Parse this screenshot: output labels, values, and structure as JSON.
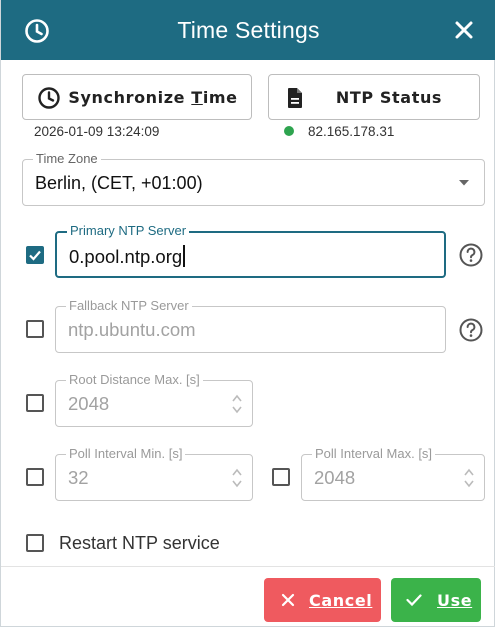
{
  "dialog": {
    "title": "Time Settings",
    "title_icon": "clock-icon",
    "close_icon": "close-icon"
  },
  "actions": {
    "sync_prefix": "Synchronize ",
    "sync_underline": "T",
    "sync_suffix": "ime",
    "sync_icon": "clock-icon",
    "sync_time": "2026-01-09 13:24:09",
    "ntp_status_label": "NTP Status",
    "ntp_status_icon": "document-icon",
    "ntp_address": "82.165.178.31",
    "ntp_status_color": "#2ea44f"
  },
  "timezone": {
    "legend": "Time Zone",
    "value": "Berlin, (CET, +01:00)"
  },
  "primary_ntp": {
    "legend": "Primary NTP Server",
    "value": "0.pool.ntp.org",
    "checked": true
  },
  "fallback_ntp": {
    "legend": "Fallback NTP Server",
    "value": "ntp.ubuntu.com",
    "checked": false
  },
  "root_distance": {
    "legend": "Root Distance Max. [s]",
    "value": "2048",
    "checked": false
  },
  "poll_min": {
    "legend": "Poll Interval Min. [s]",
    "value": "32",
    "checked": false
  },
  "poll_max": {
    "legend": "Poll Interval Max. [s]",
    "value": "2048",
    "checked": false
  },
  "restart": {
    "label": "Restart NTP service",
    "checked": false
  },
  "footer": {
    "cancel_underline": "C",
    "cancel_rest": "ancel",
    "use_underline": "U",
    "use_rest": "se",
    "cancel_color": "#ef5a5f",
    "use_color": "#3bb34a"
  },
  "colors": {
    "accent": "#1e6b82"
  }
}
